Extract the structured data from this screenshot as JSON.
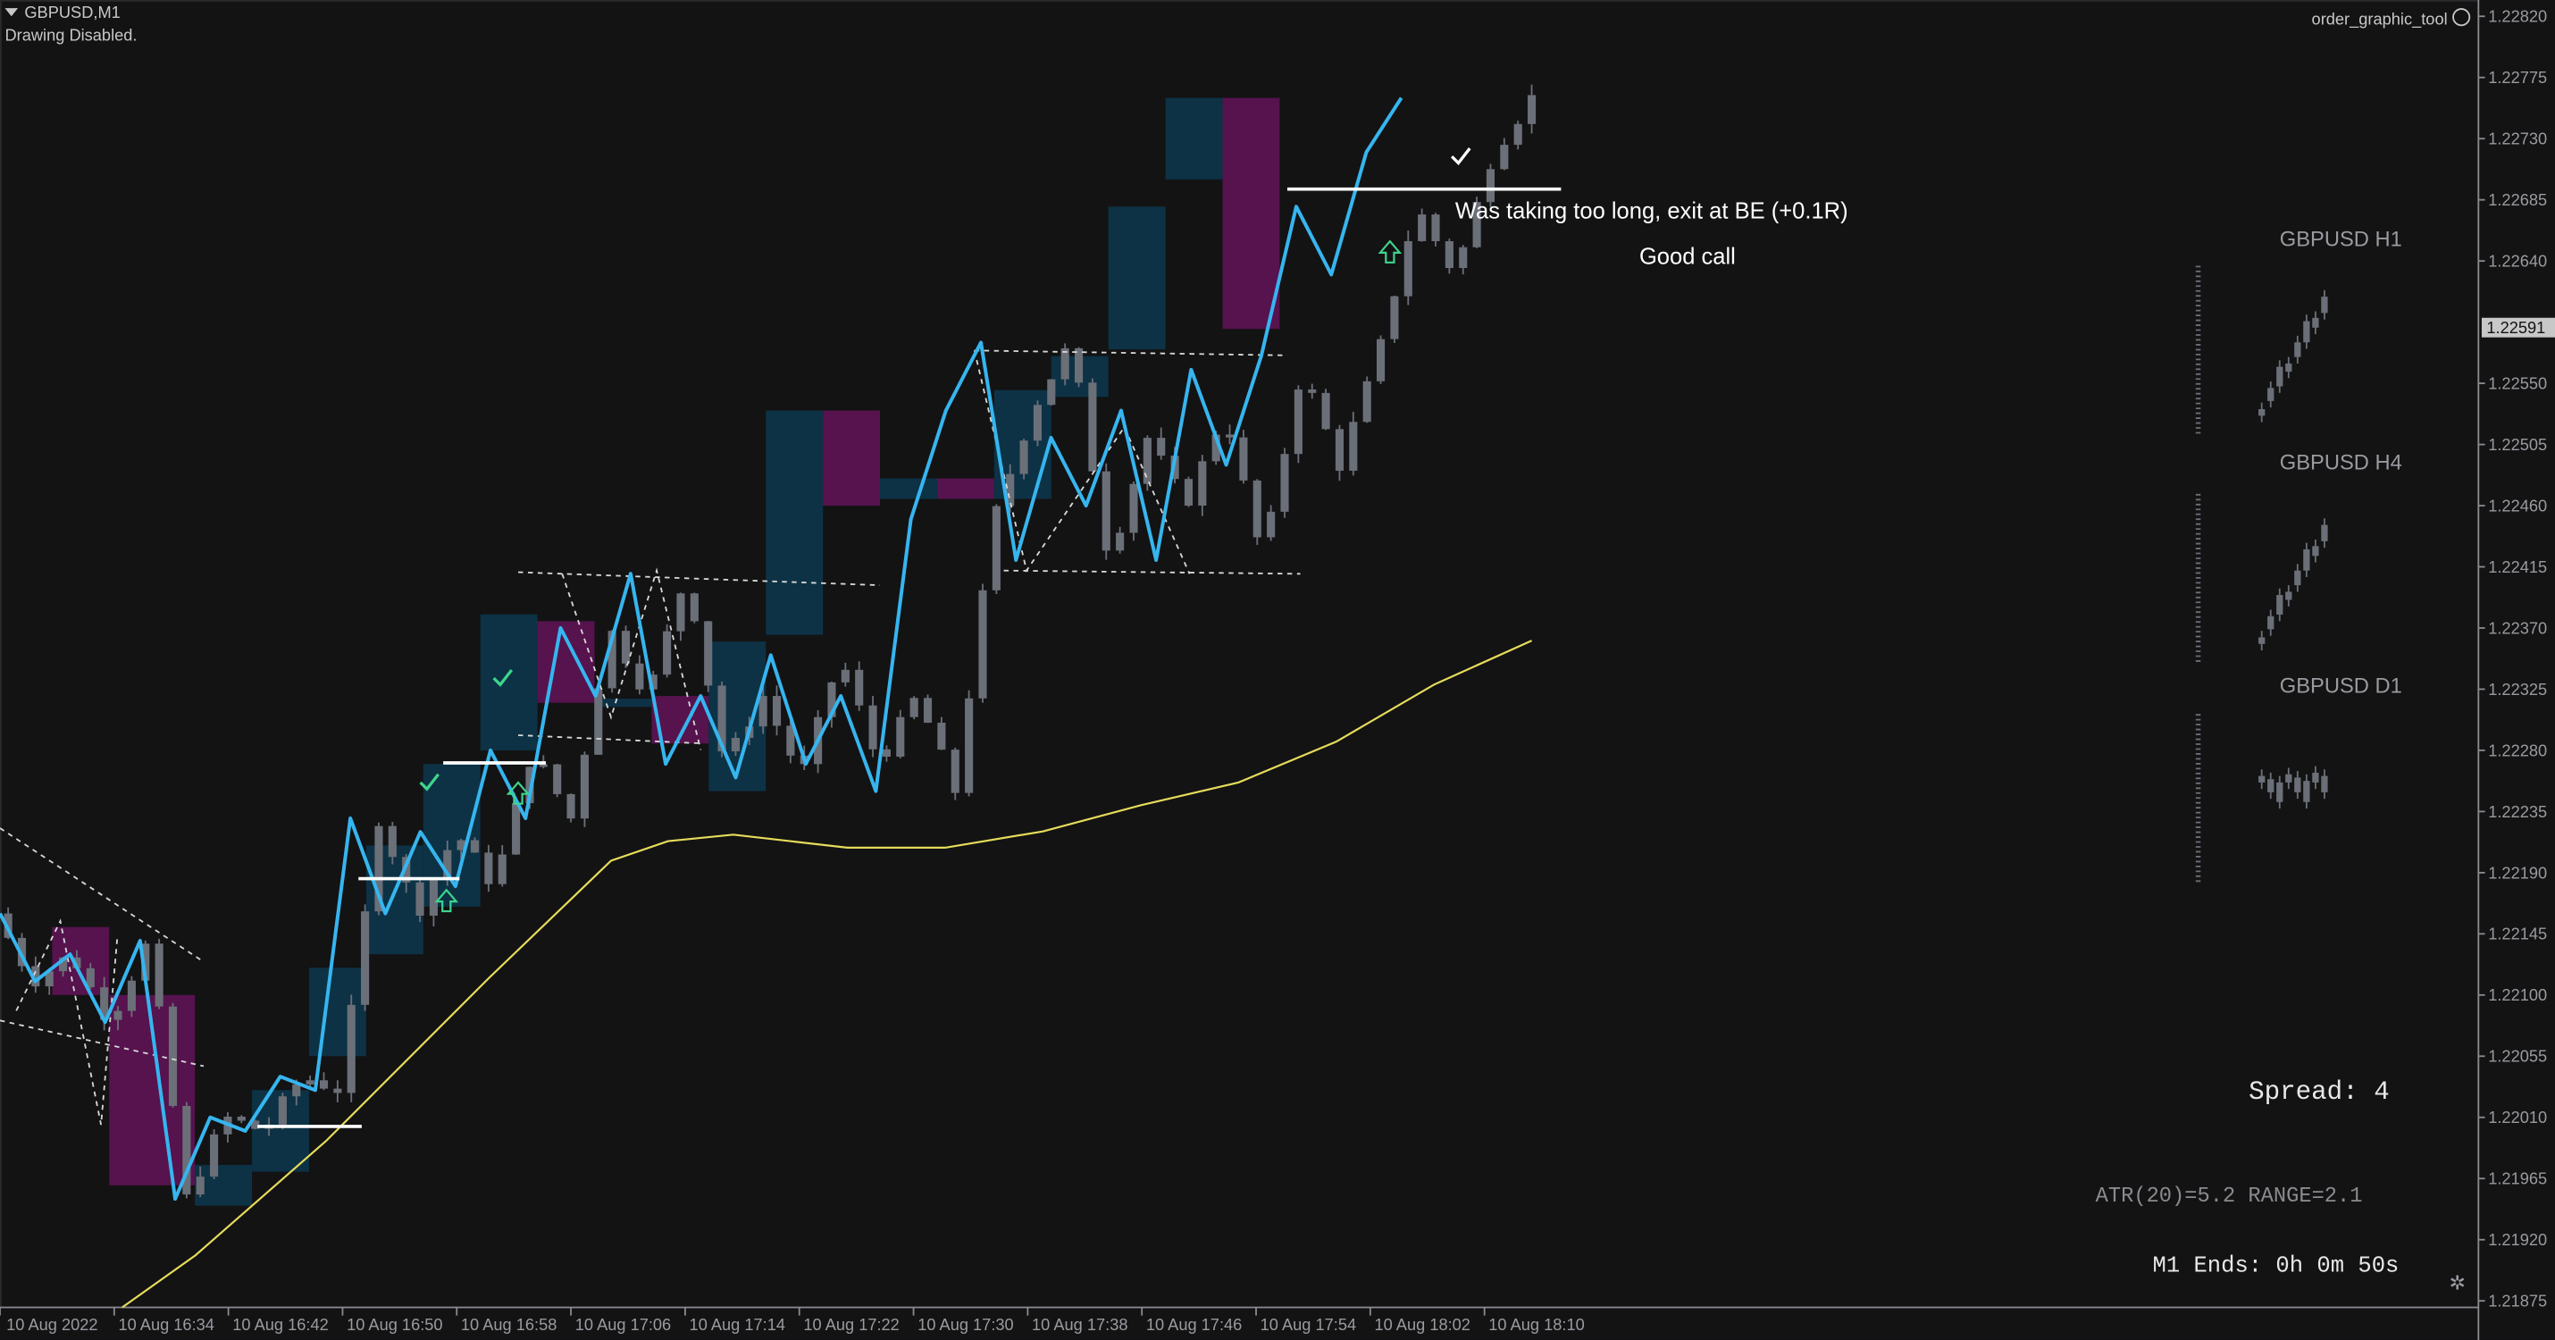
{
  "header": {
    "symbol_timeframe": "GBPUSD,M1",
    "status": "Drawing Disabled."
  },
  "expert_advisor": {
    "name": "order_graphic_tool",
    "status_icon": "smiley-icon"
  },
  "annotations": {
    "trade_note": "Was taking too long, exit at BE (+0.1R)",
    "comment": "Good call"
  },
  "info_panel": {
    "higher_timeframes": [
      "GBPUSD H1",
      "GBPUSD H4",
      "GBPUSD D1"
    ],
    "spread": "Spread: 4",
    "atr": "ATR(20)=5.2   RANGE=2.1",
    "bar_countdown": "M1 Ends: 0h 0m 50s"
  },
  "colors": {
    "background": "#131314",
    "candle": "#6b6f78",
    "zigzag": "#36b5ef",
    "moving_average": "#e6dc5a",
    "bull_zone": "#0d3448",
    "bear_zone": "#5a1351",
    "level_line": "#ffffff",
    "signal_arrow": "#3dd68c",
    "current_price_label": "#c8c8c8"
  },
  "chart_data": {
    "type": "candlestick",
    "symbol": "GBPUSD",
    "timeframe": "M1",
    "price_axis_ticks": [
      "1.22820",
      "1.22775",
      "1.22730",
      "1.22685",
      "1.22640",
      "1.22550",
      "1.22505",
      "1.22460",
      "1.22415",
      "1.22370",
      "1.22325",
      "1.22280",
      "1.22235",
      "1.22190",
      "1.22145",
      "1.22100",
      "1.22055",
      "1.22010",
      "1.21965",
      "1.21920",
      "1.21875"
    ],
    "price_range": [
      1.21875,
      1.2282
    ],
    "current_price": "1.22591",
    "time_axis_labels": [
      "10 Aug 2022",
      "10 Aug 16:34",
      "10 Aug 16:42",
      "10 Aug 16:50",
      "10 Aug 16:58",
      "10 Aug 17:06",
      "10 Aug 17:14",
      "10 Aug 17:22",
      "10 Aug 17:30",
      "10 Aug 17:38",
      "10 Aug 17:46",
      "10 Aug 17:54",
      "10 Aug 18:02",
      "10 Aug 18:10"
    ],
    "zigzag_prices": [
      1.2216,
      1.2211,
      1.2213,
      1.2208,
      1.2214,
      1.2195,
      1.2201,
      1.22,
      1.2204,
      1.2203,
      1.2223,
      1.2216,
      1.2222,
      1.2218,
      1.2228,
      1.2223,
      1.2237,
      1.2232,
      1.2241,
      1.2227,
      1.2232,
      1.2226,
      1.2235,
      1.2227,
      1.2232,
      1.2225,
      1.2245,
      1.2253,
      1.2258,
      1.2242,
      1.2251,
      1.2246,
      1.2253,
      1.2242,
      1.2256,
      1.2249,
      1.2257,
      1.2268,
      1.2263,
      1.2272,
      1.2276
    ]
  }
}
